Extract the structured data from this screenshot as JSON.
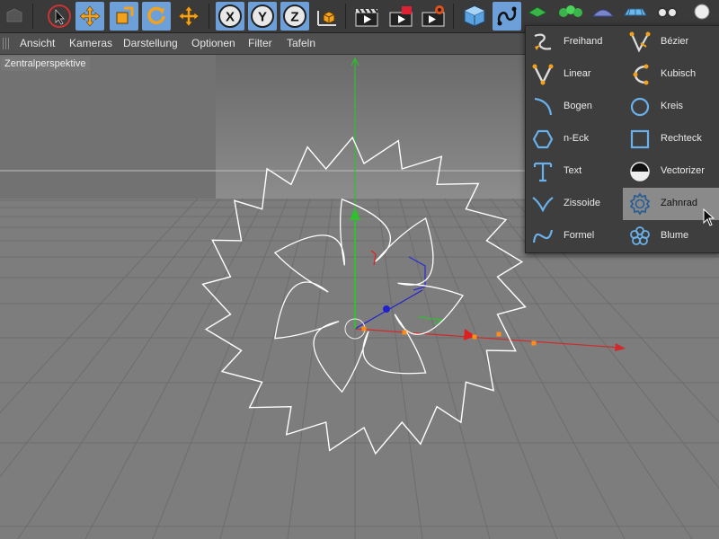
{
  "toolbar": {
    "buttons": [
      {
        "name": "undo-button",
        "icon": "undo-icon"
      },
      {
        "name": "live-selection-button",
        "icon": "cursor-arrow-icon"
      },
      {
        "name": "move-tool-button",
        "icon": "move-arrows-icon"
      },
      {
        "name": "scale-tool-button",
        "icon": "scale-icon"
      },
      {
        "name": "rotate-tool-button",
        "icon": "rotate-icon"
      },
      {
        "name": "last-tool-button",
        "icon": "cross-arrows-icon"
      },
      {
        "name": "x-axis-lock-button",
        "label": "X"
      },
      {
        "name": "y-axis-lock-button",
        "label": "Y"
      },
      {
        "name": "z-axis-lock-button",
        "label": "Z"
      },
      {
        "name": "coordinate-system-button",
        "icon": "cube-axes-icon"
      },
      {
        "name": "render-view-button",
        "icon": "clapperboard-icon"
      },
      {
        "name": "render-picture-viewer-button",
        "icon": "clapperboard-red-icon"
      },
      {
        "name": "render-settings-button",
        "icon": "clapperboard-gear-icon"
      },
      {
        "name": "cube-object-button",
        "icon": "cube-icon"
      },
      {
        "name": "spline-button",
        "icon": "spline-pen-icon"
      },
      {
        "name": "nurbs-button",
        "icon": "nurbs-icon"
      },
      {
        "name": "array-button",
        "icon": "array-icon"
      },
      {
        "name": "deformer-button",
        "icon": "deformer-icon"
      },
      {
        "name": "scene-button",
        "icon": "floor-icon"
      },
      {
        "name": "camera-button",
        "icon": "camera-icon"
      },
      {
        "name": "light-button",
        "icon": "light-icon"
      }
    ],
    "axis_labels": {
      "x": "X",
      "y": "Y",
      "z": "Z"
    }
  },
  "menubar": {
    "items": [
      "Ansicht",
      "Kameras",
      "Darstellung",
      "Optionen",
      "Filter",
      "Tafeln"
    ]
  },
  "viewport": {
    "label": "Zentralperspektive"
  },
  "spline_menu": {
    "items": [
      {
        "label": "Freihand",
        "icon": "freehand-spline-icon"
      },
      {
        "label": "Bézier",
        "icon": "bezier-spline-icon"
      },
      {
        "label": "Linear",
        "icon": "linear-spline-icon"
      },
      {
        "label": "Kubisch",
        "icon": "cubic-spline-icon"
      },
      {
        "label": "Bogen",
        "icon": "arc-icon"
      },
      {
        "label": "Kreis",
        "icon": "circle-icon"
      },
      {
        "label": "n-Eck",
        "icon": "hexagon-icon"
      },
      {
        "label": "Rechteck",
        "icon": "rectangle-icon"
      },
      {
        "label": "Text",
        "icon": "text-icon"
      },
      {
        "label": "Vectorizer",
        "icon": "vectorizer-icon"
      },
      {
        "label": "Zissoide",
        "icon": "cissoid-icon"
      },
      {
        "label": "Zahnrad",
        "icon": "gear-icon",
        "active": true
      },
      {
        "label": "Formel",
        "icon": "formula-icon"
      },
      {
        "label": "Blume",
        "icon": "flower-icon"
      }
    ]
  },
  "colors": {
    "toolbar_bg": "#3a3a3a",
    "highlight": "#6d9fd8",
    "axis_x": "#d02a2a",
    "axis_y": "#2fbf2f",
    "axis_z": "#2222cc",
    "spline": "#ffffff",
    "point": "#ff8c1a",
    "icon_blue": "#6ab0ea"
  }
}
